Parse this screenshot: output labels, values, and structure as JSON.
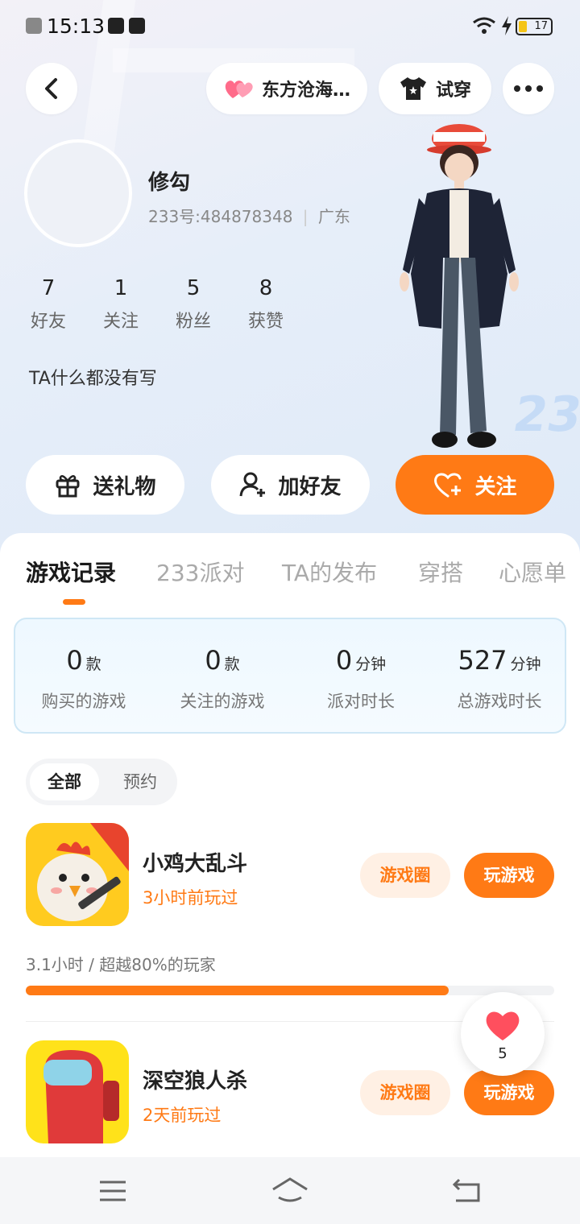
{
  "status_bar": {
    "time": "15:13",
    "battery": "17"
  },
  "header": {
    "pet_chip": "东方沧海…",
    "tryon_label": "试穿"
  },
  "profile": {
    "name": "修勾",
    "uid": "233号:484878348",
    "location": "广东",
    "bio": "TA什么都没有写",
    "stats": [
      {
        "value": "7",
        "label": "好友"
      },
      {
        "value": "1",
        "label": "关注"
      },
      {
        "value": "5",
        "label": "粉丝"
      },
      {
        "value": "8",
        "label": "获赞"
      }
    ]
  },
  "actions": {
    "gift": "送礼物",
    "add_friend": "加好友",
    "follow": "关注"
  },
  "tabs": [
    "游戏记录",
    "233派对",
    "TA的发布",
    "穿搭",
    "心愿单"
  ],
  "summary": [
    {
      "value": "0",
      "unit": "款",
      "label": "购买的游戏"
    },
    {
      "value": "0",
      "unit": "款",
      "label": "关注的游戏"
    },
    {
      "value": "0",
      "unit": "分钟",
      "label": "派对时长"
    },
    {
      "value": "527",
      "unit": "分钟",
      "label": "总游戏时长"
    }
  ],
  "filter": {
    "all": "全部",
    "reserve": "预约"
  },
  "games": [
    {
      "name": "小鸡大乱斗",
      "last_played": "3小时前玩过",
      "circle": "游戏圈",
      "play": "玩游戏",
      "stats_text": "3.1小时 / 超越80%的玩家",
      "percentile": 0.8
    },
    {
      "name": "深空狼人杀",
      "last_played": "2天前玩过",
      "circle": "游戏圈",
      "play": "玩游戏"
    }
  ],
  "like_float": {
    "count": "5"
  },
  "colors": {
    "accent": "#ff7a15",
    "accent_light": "#fff0e4"
  }
}
